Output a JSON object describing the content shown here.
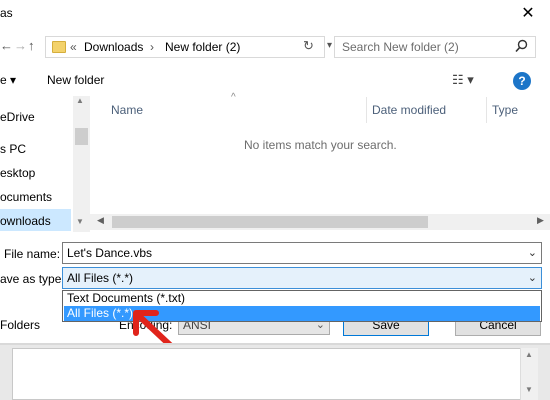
{
  "window": {
    "title_fragment": "as",
    "close_glyph": "✕"
  },
  "nav": {
    "back_glyph": "←",
    "forward_glyph": "→",
    "up_glyph": "↑",
    "breadcrumb": [
      "«",
      "Downloads",
      "›",
      "New folder (2)"
    ],
    "refresh_glyph": "↻",
    "search_placeholder": "Search New folder (2)"
  },
  "toolbar": {
    "organize_fragment": "e ▾",
    "new_folder_label": "New folder",
    "view_glyph": "☷ ▾",
    "help_label": "?"
  },
  "sidebar": {
    "items": [
      {
        "label": "eDrive"
      },
      {
        "label": "s PC"
      },
      {
        "label": "esktop"
      },
      {
        "label": "ocuments"
      },
      {
        "label": "ownloads",
        "selected": true
      }
    ]
  },
  "columns": [
    "Name",
    "Date modified",
    "Type"
  ],
  "empty_message": "No items match your search.",
  "form": {
    "file_name_label": "File name:",
    "file_name_value": "Let's Dance.vbs",
    "save_type_label": "ave as type:",
    "save_type_value": "All Files  (*.*)",
    "type_options": [
      {
        "label": "Text Documents (*.txt)",
        "selected": false
      },
      {
        "label": "All Files  (*.*)",
        "selected": true
      }
    ],
    "folders_label": "Folders",
    "encoding_label": "Encoding:",
    "encoding_value": "ANSI",
    "save_label": "Save",
    "cancel_label": "Cancel"
  },
  "colors": {
    "accent": "#0078d7",
    "selection": "#3399ff",
    "arrow": "#e0241b",
    "help": "#1c75c8"
  }
}
